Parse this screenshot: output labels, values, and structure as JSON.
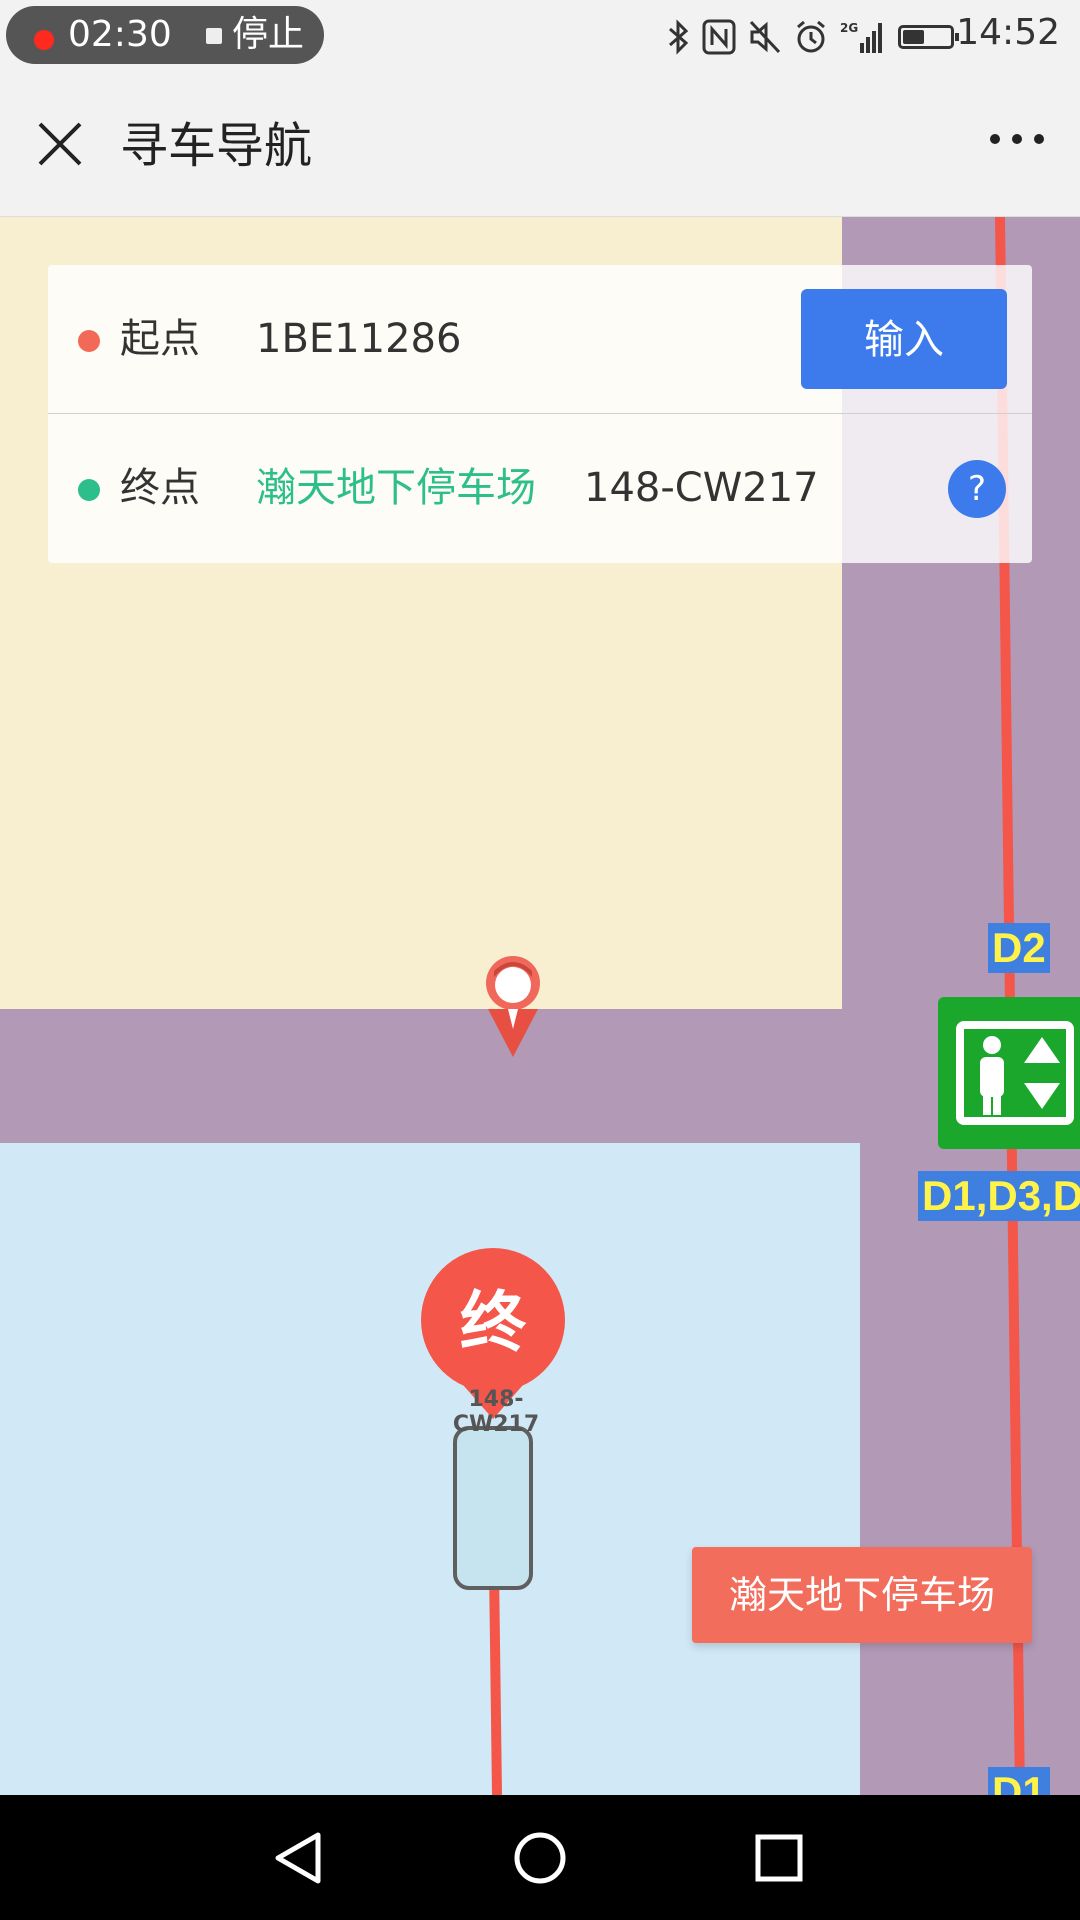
{
  "status_bar": {
    "recording_time": "02:30",
    "recording_stop_label": "停止",
    "clock": "14:52",
    "network_type": "2G",
    "battery_percent": 45,
    "icons": [
      "bluetooth-icon",
      "nfc-icon",
      "mute-icon",
      "alarm-icon",
      "signal-icon",
      "battery-icon"
    ]
  },
  "title_bar": {
    "title": "寻车导航",
    "close_icon": "close-icon",
    "more_icon": "more-icon"
  },
  "search": {
    "start": {
      "label": "起点",
      "value": "1BE11286",
      "button_label": "输入",
      "dot_color": "#f26a57"
    },
    "end": {
      "label": "终点",
      "lot_name": "瀚天地下停车场",
      "slot": "148-CW217",
      "help_label": "?",
      "dot_color": "#2dbf8b"
    }
  },
  "map": {
    "end_marker_char": "终",
    "end_marker_label": "148-CW217",
    "lot_tag": "瀚天地下停车场",
    "floor_labels": [
      "D2",
      "D1,D3,D",
      "D1"
    ],
    "colors": {
      "corridor": "#b29ab7",
      "zone_yellow": "#f8eed0",
      "zone_blue": "#d1e8f7",
      "route": "#f5564a",
      "elevator": "#1aa72b"
    }
  }
}
